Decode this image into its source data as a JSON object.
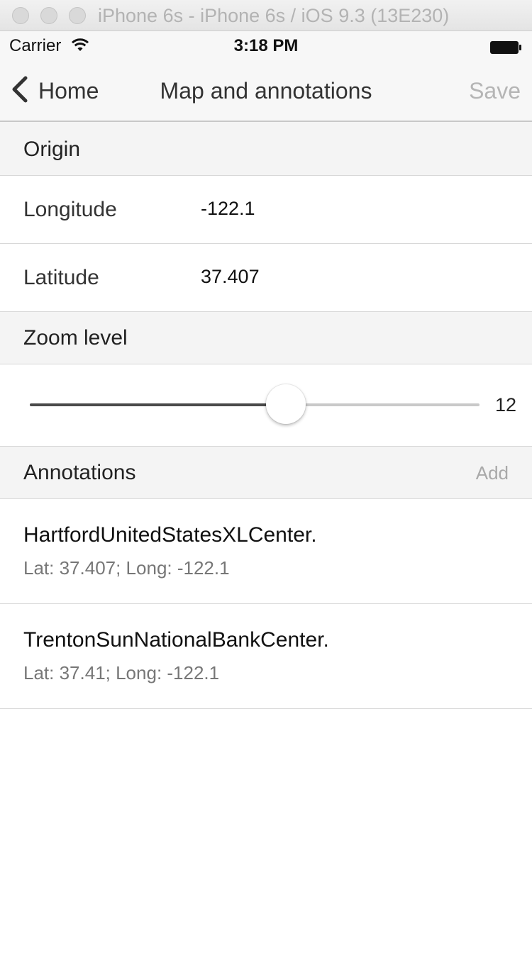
{
  "window": {
    "title": "iPhone 6s - iPhone 6s / iOS 9.3 (13E230)"
  },
  "status_bar": {
    "carrier": "Carrier",
    "time": "3:18 PM",
    "wifi_icon": "wifi-icon",
    "battery_icon": "battery-icon"
  },
  "nav": {
    "back_label": "Home",
    "title": "Map and annotations",
    "save_label": "Save"
  },
  "origin": {
    "header": "Origin",
    "longitude_label": "Longitude",
    "longitude_value": "-122.1",
    "latitude_label": "Latitude",
    "latitude_value": "37.407"
  },
  "zoom": {
    "header": "Zoom level",
    "value": "12",
    "slider_fraction": 0.57
  },
  "annotations": {
    "header": "Annotations",
    "add_label": "Add",
    "items": [
      {
        "title": "HartfordUnitedStatesXLCenter.",
        "subtitle": "Lat: 37.407; Long: -122.1"
      },
      {
        "title": "TrentonSunNationalBankCenter.",
        "subtitle": "Lat: 37.41; Long: -122.1"
      }
    ]
  },
  "colors": {
    "nav_bg": "#f7f7f7",
    "section_bg": "#f4f4f4",
    "disabled_text": "#b5b5b5",
    "slider_fill": "#4a4a4a"
  }
}
